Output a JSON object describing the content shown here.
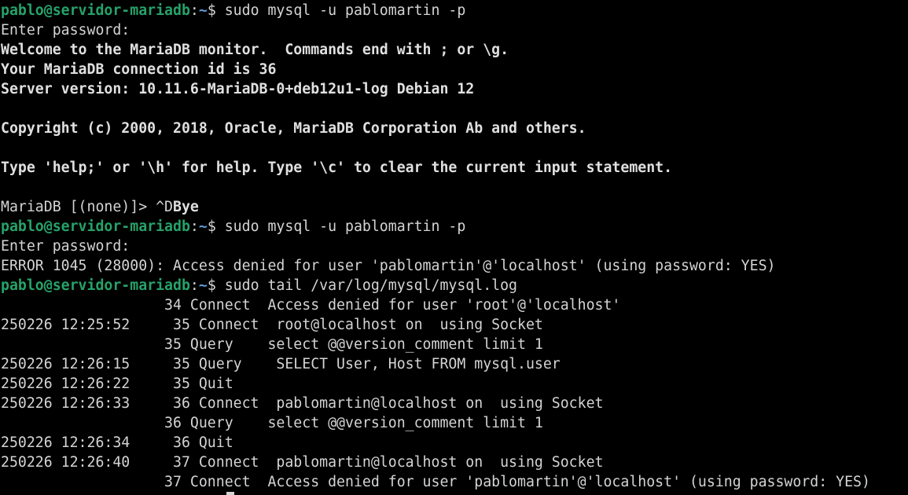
{
  "terminal": {
    "prompt_user": "pablo@servidor-mariadb",
    "prompt_path": "~",
    "prompt_symbol": "$",
    "lines": [
      {
        "kind": "prompt",
        "cmd": " sudo mysql -u pablomartin -p"
      },
      {
        "kind": "text",
        "text": "Enter password:"
      },
      {
        "kind": "bold",
        "text": "Welcome to the MariaDB monitor.  Commands end with ; or \\g."
      },
      {
        "kind": "bold",
        "text": "Your MariaDB connection id is 36"
      },
      {
        "kind": "bold",
        "text": "Server version: 10.11.6-MariaDB-0+deb12u1-log Debian 12"
      },
      {
        "kind": "blank",
        "text": ""
      },
      {
        "kind": "bold",
        "text": "Copyright (c) 2000, 2018, Oracle, MariaDB Corporation Ab and others."
      },
      {
        "kind": "blank",
        "text": ""
      },
      {
        "kind": "bold",
        "text": "Type 'help;' or '\\h' for help. Type '\\c' to clear the current input statement."
      },
      {
        "kind": "blank",
        "text": ""
      },
      {
        "kind": "mixed",
        "text": "MariaDB [(none)]> ^D",
        "bold_text": "Bye"
      },
      {
        "kind": "prompt",
        "cmd": " sudo mysql -u pablomartin -p"
      },
      {
        "kind": "text",
        "text": "Enter password:"
      },
      {
        "kind": "text",
        "text": "ERROR 1045 (28000): Access denied for user 'pablomartin'@'localhost' (using password: YES)"
      },
      {
        "kind": "prompt",
        "cmd": " sudo tail /var/log/mysql/mysql.log"
      },
      {
        "kind": "text",
        "text": "                   34 Connect  Access denied for user 'root'@'localhost'"
      },
      {
        "kind": "text",
        "text": "250226 12:25:52     35 Connect  root@localhost on  using Socket"
      },
      {
        "kind": "text",
        "text": "                   35 Query    select @@version_comment limit 1"
      },
      {
        "kind": "text",
        "text": "250226 12:26:15     35 Query    SELECT User, Host FROM mysql.user"
      },
      {
        "kind": "text",
        "text": "250226 12:26:22     35 Quit"
      },
      {
        "kind": "text",
        "text": "250226 12:26:33     36 Connect  pablomartin@localhost on  using Socket"
      },
      {
        "kind": "text",
        "text": "                   36 Query    select @@version_comment limit 1"
      },
      {
        "kind": "text",
        "text": "250226 12:26:34     36 Quit"
      },
      {
        "kind": "text",
        "text": "250226 12:26:40     37 Connect  pablomartin@localhost on  using Socket"
      },
      {
        "kind": "text",
        "text": "                   37 Connect  Access denied for user 'pablomartin'@'localhost' (using password: YES)"
      }
    ]
  }
}
